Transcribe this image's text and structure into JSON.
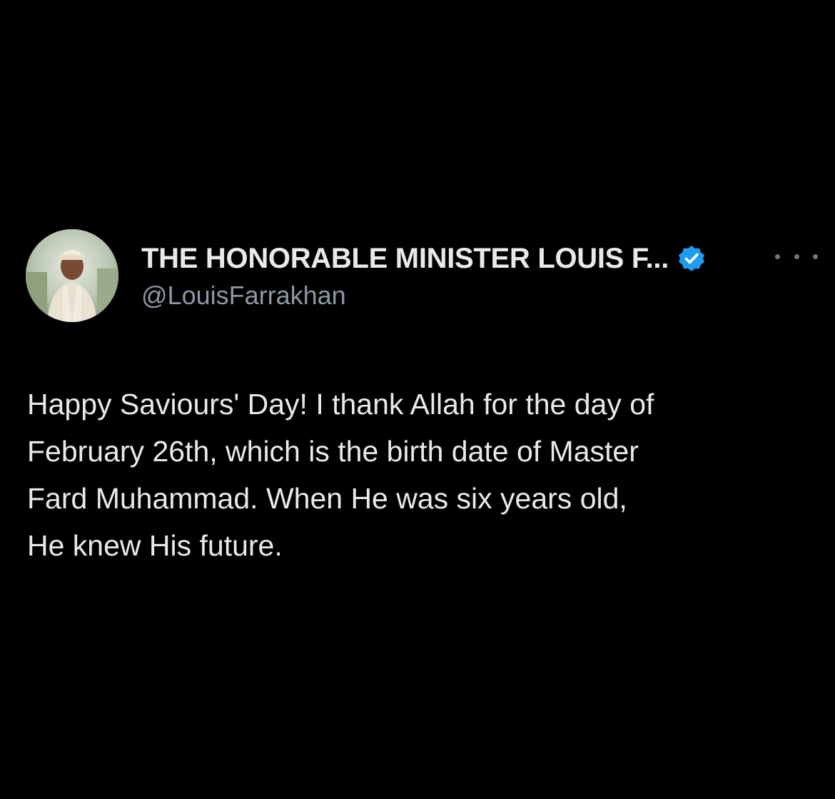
{
  "author": {
    "display_name": "THE HONORABLE MINISTER LOUIS F...",
    "handle": "@LouisFarrakhan",
    "verified": true,
    "verified_color": "#1d9bf0",
    "avatar_icon": "profile-photo"
  },
  "menu": {
    "more_icon": "ellipsis-icon"
  },
  "tweet": {
    "text": "Happy Saviours' Day! I thank Allah for the day of\nFebruary 26th, which is the birth date of Master\nFard Muhammad. When He was six years old,\nHe knew His future."
  },
  "theme": {
    "background": "#000000",
    "text": "#e7e9ea",
    "secondary_text": "#8b98a5"
  }
}
